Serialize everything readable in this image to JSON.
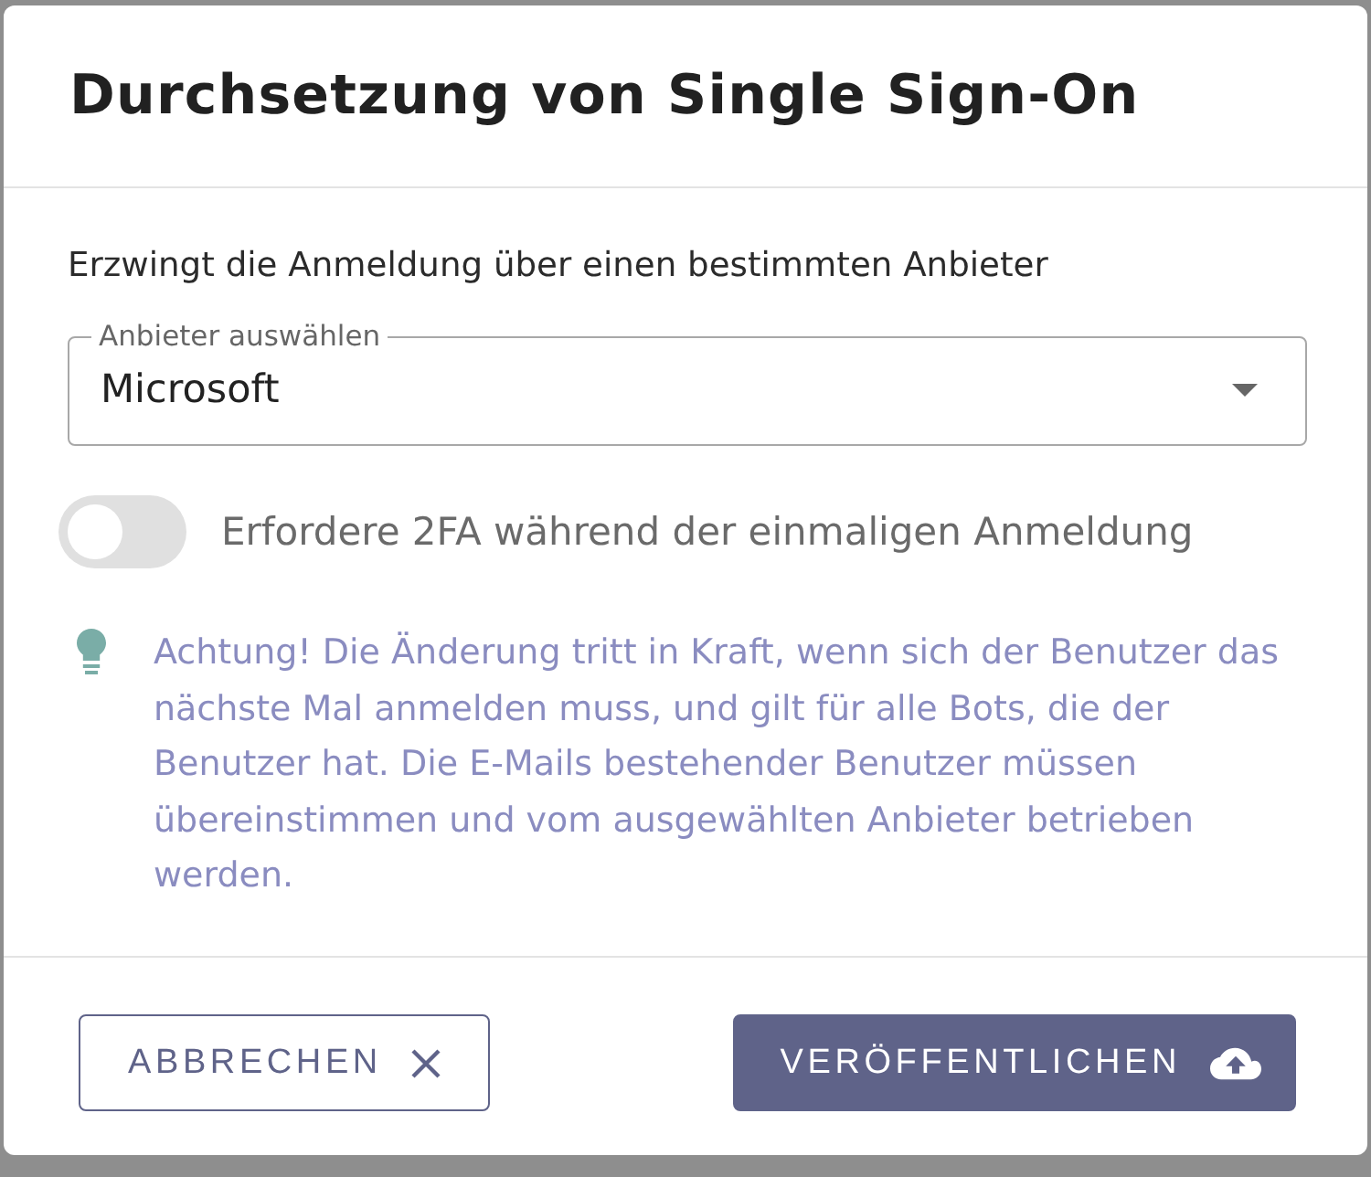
{
  "dialog": {
    "title": "Durchsetzung von Single Sign-On",
    "description": "Erzwingt die Anmeldung über einen bestimmten Anbieter",
    "provider_select": {
      "label": "Anbieter auswählen",
      "value": "Microsoft"
    },
    "toggle": {
      "label": "Erfordere 2FA während der einmaligen Anmeldung",
      "on": false
    },
    "info": "Achtung! Die Änderung tritt in Kraft, wenn sich der Benutzer das nächste Mal anmelden muss, und gilt für alle Bots, die der Benutzer hat. Die E-Mails bestehender Benutzer müssen übereinstimmen und vom ausgewählten Anbieter betrieben werden.",
    "buttons": [
      {
        "kind": "secondary",
        "label": "ABBRECHEN"
      },
      {
        "kind": "primary",
        "label": "VERÖFFENTLICHEN"
      }
    ]
  }
}
